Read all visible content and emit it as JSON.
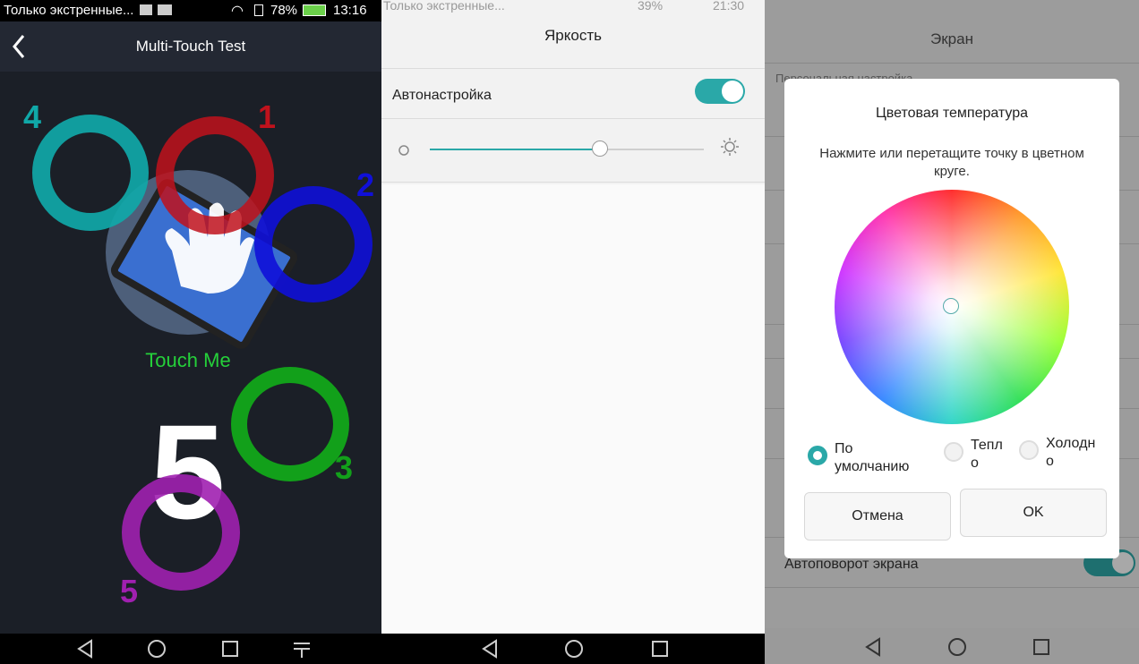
{
  "panel1": {
    "status": {
      "notification": "Только экстренные...",
      "battery": "78%",
      "time": "13:16"
    },
    "title": "Multi-Touch Test",
    "touch_label": "Touch Me",
    "big_count": "5",
    "touch_points": [
      {
        "label": "1",
        "color": "#c0121c"
      },
      {
        "label": "2",
        "color": "#1010d8"
      },
      {
        "label": "3",
        "color": "#12a01a"
      },
      {
        "label": "4",
        "color": "#10a8a8"
      },
      {
        "label": "5",
        "color": "#a020b0"
      }
    ]
  },
  "panel2": {
    "status": {
      "notification": "Только экстренные...",
      "battery": "39%",
      "time": "21:30"
    },
    "title": "Яркость",
    "auto_label": "Автонастройка",
    "auto_enabled": true,
    "brightness_level": 0.62,
    "accent": "#2aa8a8"
  },
  "panel3": {
    "bg_title": "Экран",
    "bg_row_top": "Персональная настройка",
    "bg_row_bottom": "Автоповорот экрана",
    "dialog": {
      "title": "Цветовая температура",
      "instruction": "Нажмите или перетащите точку в цветном круге.",
      "options": [
        {
          "label": "По\nумолчанию",
          "selected": true
        },
        {
          "label": "Тепл\nо",
          "selected": false
        },
        {
          "label": "Холодн\nо",
          "selected": false
        }
      ],
      "cancel": "Отмена",
      "ok": "OK"
    }
  }
}
